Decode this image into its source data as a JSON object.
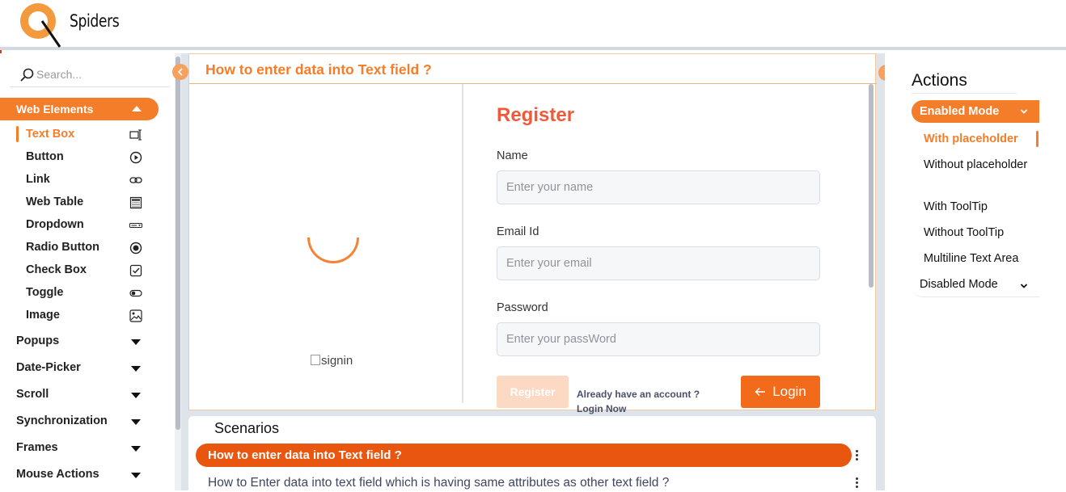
{
  "brand": {
    "logo_text": "Spiders"
  },
  "search": {
    "placeholder": "Search..."
  },
  "sidebar": {
    "active_section": "Web Elements",
    "sub_items": [
      {
        "label": "Text Box",
        "icon": "textbox-icon"
      },
      {
        "label": "Button",
        "icon": "play-circle-icon"
      },
      {
        "label": "Link",
        "icon": "link-icon"
      },
      {
        "label": "Web Table",
        "icon": "table-icon"
      },
      {
        "label": "Dropdown",
        "icon": "dropdown-icon"
      },
      {
        "label": "Radio Button",
        "icon": "radio-icon"
      },
      {
        "label": "Check Box",
        "icon": "checkbox-icon"
      },
      {
        "label": "Toggle",
        "icon": "toggle-icon"
      },
      {
        "label": "Image",
        "icon": "image-icon"
      }
    ],
    "categories": [
      "Popups",
      "Date-Picker",
      "Scroll",
      "Synchronization",
      "Frames",
      "Mouse Actions"
    ]
  },
  "demo": {
    "title": "How to enter data into Text field ?",
    "image_alt": "signin",
    "form": {
      "heading": "Register",
      "name_label": "Name",
      "name_placeholder": "Enter your name",
      "email_label": "Email Id",
      "email_placeholder": "Enter your email",
      "password_label": "Password",
      "password_placeholder": "Enter your passWord",
      "register_label": "Register",
      "already_text": "Already have an account ?",
      "login_now_text": "Login Now",
      "login_label": "Login"
    }
  },
  "scenarios": {
    "title": "Scenarios",
    "items": [
      "How to enter data into Text field ?",
      "How to Enter data into text field which is having same attributes as other text field ?"
    ]
  },
  "actions": {
    "title": "Actions",
    "enabled_mode": "Enabled Mode",
    "items": [
      "With placeholder",
      "Without placeholder",
      "With ToolTip",
      "Without ToolTip",
      "Multiline Text Area"
    ],
    "disabled_mode": "Disabled Mode"
  },
  "colors": {
    "accent": "#f47d2a",
    "scenario_active": "#e8560f",
    "register_heading": "#f05a3a"
  }
}
